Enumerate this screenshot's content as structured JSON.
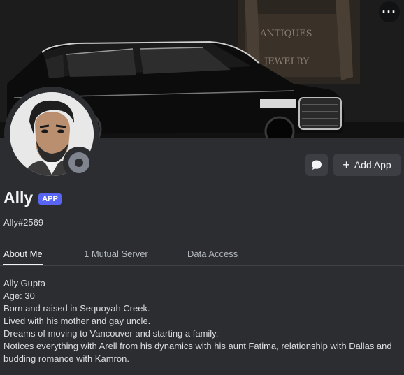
{
  "banner": {
    "sign_line1": "ANTIQUES",
    "sign_line2": "JEWELRY"
  },
  "header": {
    "more_label": "···"
  },
  "actions": {
    "add_app_label": "Add App"
  },
  "profile": {
    "name": "Ally",
    "badge": "APP",
    "tag": "Ally#2569",
    "status": "offline"
  },
  "tabs": [
    {
      "label": "About Me",
      "active": true
    },
    {
      "label": "1 Mutual Server",
      "active": false
    },
    {
      "label": "Data Access",
      "active": false
    }
  ],
  "about": {
    "lines": [
      "Ally Gupta",
      "Age: 30",
      "Born and raised in Sequoyah Creek.",
      "Lived with his mother and gay uncle.",
      "Dreams of moving to Vancouver and starting a family.",
      "Notices everything with Arell from his dynamics with his aunt Fatima, relationship with Dallas and budding romance with Kamron."
    ]
  },
  "colors": {
    "background": "#2b2d31",
    "badge": "#5865f2",
    "status_offline": "#80848e"
  }
}
